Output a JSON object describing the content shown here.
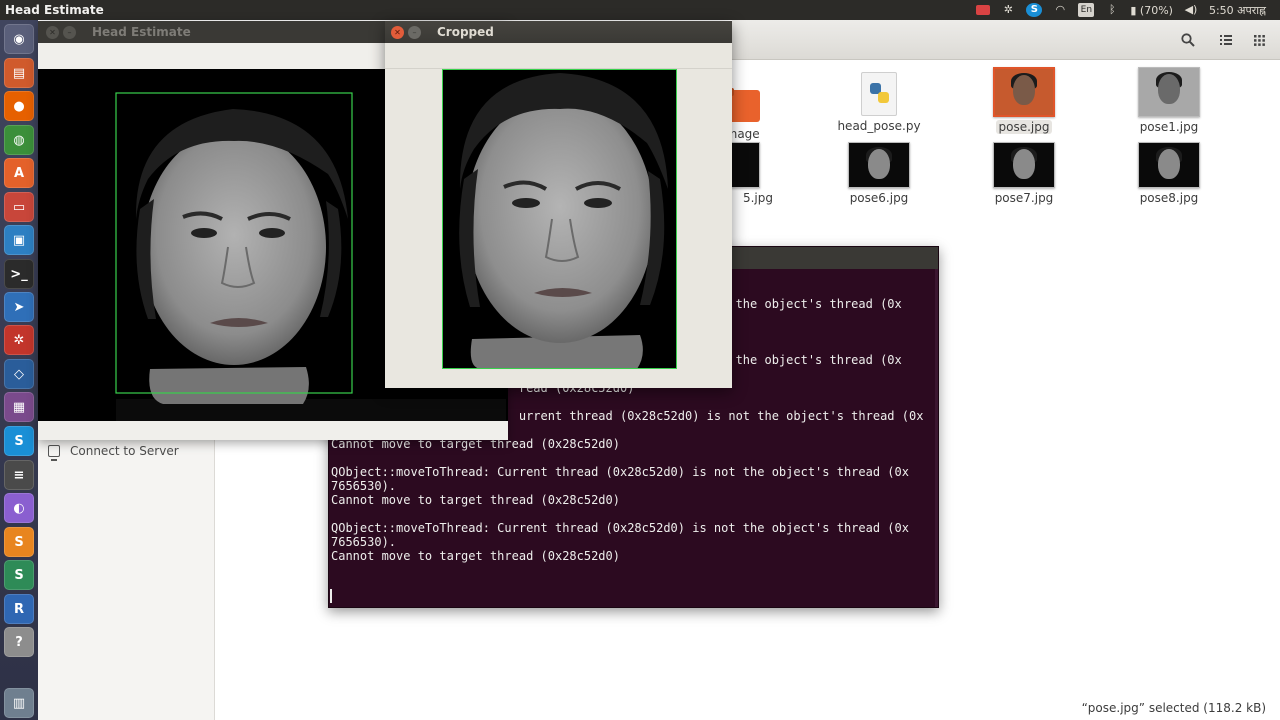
{
  "top_panel": {
    "title": "Head Estimate",
    "battery": "(70%)",
    "time": "5:50 अपराह्न",
    "keyboard": "En",
    "icons": [
      "camera-icon",
      "settings-icon",
      "skype-icon",
      "wifi-icon",
      "keyboard-icon",
      "bluetooth-icon",
      "battery-icon",
      "volume-icon"
    ]
  },
  "launcher": {
    "items": [
      {
        "name": "dash-icon",
        "glyph": "◉",
        "color": "#5a5f7a"
      },
      {
        "name": "text-editor-icon",
        "glyph": "▤",
        "color": "#d05a2c"
      },
      {
        "name": "firefox-icon",
        "glyph": "●",
        "color": "#e66000"
      },
      {
        "name": "chrome-icon",
        "glyph": "◍",
        "color": "#3b8f3a"
      },
      {
        "name": "software-center-icon",
        "glyph": "A",
        "color": "#e4612a"
      },
      {
        "name": "file-manager-icon",
        "glyph": "▭",
        "color": "#c8463a"
      },
      {
        "name": "libreoffice-icon",
        "glyph": "▣",
        "color": "#2d7fc2"
      },
      {
        "name": "terminal-icon",
        "glyph": ">_",
        "color": "#2b2b2b"
      },
      {
        "name": "browser-icon",
        "glyph": "➤",
        "color": "#2f6fb8"
      },
      {
        "name": "system-settings-icon",
        "glyph": "✲",
        "color": "#c2352b"
      },
      {
        "name": "virtualbox-icon",
        "glyph": "◇",
        "color": "#2a5d9a"
      },
      {
        "name": "screenshot-icon",
        "glyph": "▦",
        "color": "#7a4a8c"
      },
      {
        "name": "skype-icon",
        "glyph": "S",
        "color": "#1a8fd6"
      },
      {
        "name": "layers-icon",
        "glyph": "≡",
        "color": "#4a4a4a"
      },
      {
        "name": "circle-app-icon",
        "glyph": "◐",
        "color": "#8a5fd0"
      },
      {
        "name": "sublime-icon",
        "glyph": "S",
        "color": "#e8851f"
      },
      {
        "name": "sheet-icon",
        "glyph": "S",
        "color": "#2e8b57"
      },
      {
        "name": "r-icon",
        "glyph": "R",
        "color": "#2f67b3"
      },
      {
        "name": "help-icon",
        "glyph": "?",
        "color": "#8d8d8d"
      },
      {
        "name": "trash-icon",
        "glyph": "▥",
        "color": "#6f7f8f"
      }
    ]
  },
  "file_manager": {
    "sidebar": {
      "connect_label": "Connect to Server"
    },
    "files": [
      {
        "name": "_image",
        "type": "folder"
      },
      {
        "name": "head_pose.py",
        "type": "python"
      },
      {
        "name": "pose.jpg",
        "type": "image",
        "selected": true
      },
      {
        "name": "pose1.jpg",
        "type": "image"
      },
      {
        "name": "5.jpg",
        "type": "image"
      },
      {
        "name": "pose6.jpg",
        "type": "image"
      },
      {
        "name": "pose7.jpg",
        "type": "image"
      },
      {
        "name": "pose8.jpg",
        "type": "image"
      }
    ],
    "status": "“pose.jpg” selected  (118.2 kB)"
  },
  "terminal": {
    "lines": [
      "",
      "",
      "                                                     ot the object's thread (0x",
      "",
      "",
      "",
      "                                                     ot the object's thread (0x",
      "",
      "                          read (0x28c52d0)",
      "",
      "                          urrent thread (0x28c52d0) is not the object's thread (0x",
      "7656530).",
      "Cannot move to target thread (0x28c52d0)",
      "",
      "QObject::moveToThread: Current thread (0x28c52d0) is not the object's thread (0x",
      "7656530).",
      "Cannot move to target thread (0x28c52d0)",
      "",
      "QObject::moveToThread: Current thread (0x28c52d0) is not the object's thread (0x",
      "7656530).",
      "Cannot move to target thread (0x28c52d0)"
    ]
  },
  "head_estimate_window": {
    "title": "Head Estimate"
  },
  "cropped_window": {
    "title": "Cropped"
  },
  "colors": {
    "terminal_bg": "#2c0a20",
    "face_box": "#38d04c",
    "selection": "#e0552a"
  }
}
